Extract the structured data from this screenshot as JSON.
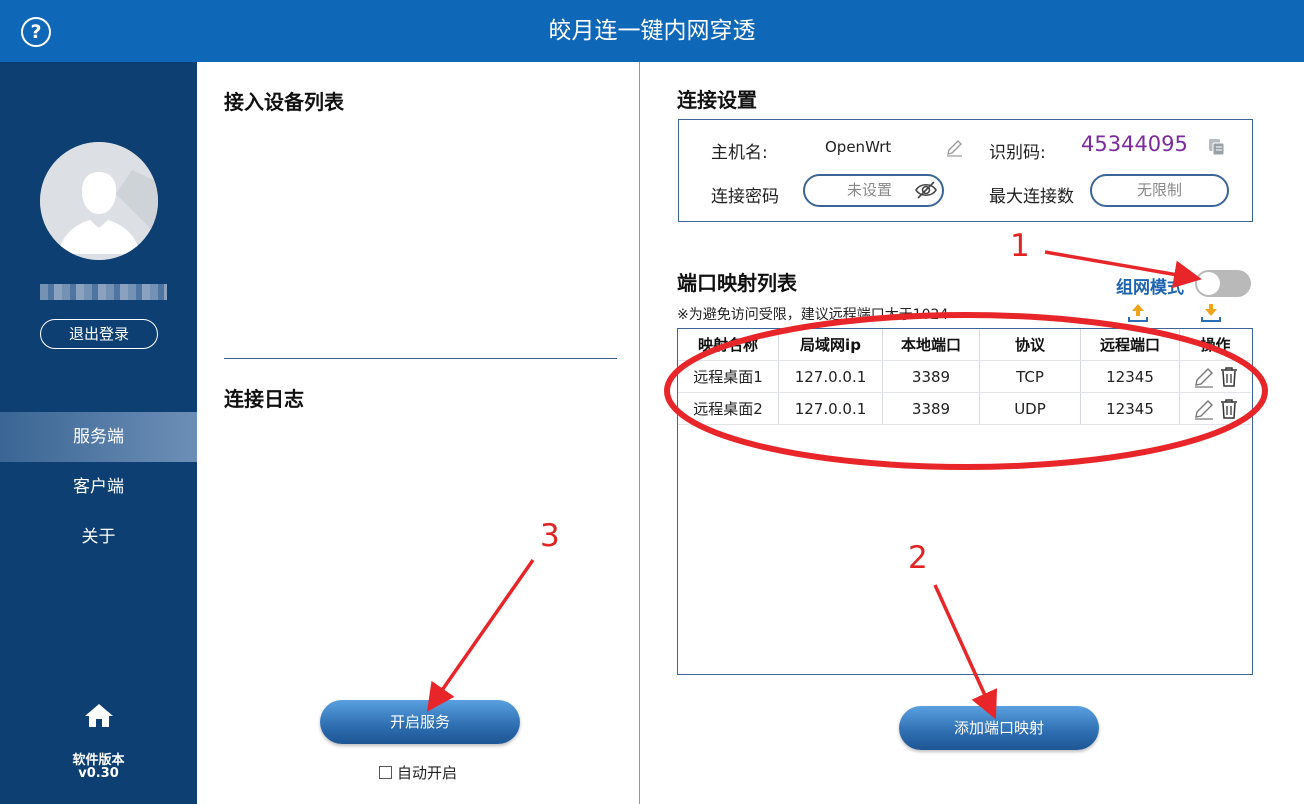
{
  "window": {
    "title": "皎月连一键内网穿透",
    "help_icon": "question-circle-icon"
  },
  "sidebar": {
    "logout_label": "退出登录",
    "nav": [
      {
        "label": "服务端",
        "active": true
      },
      {
        "label": "客户端",
        "active": false
      },
      {
        "label": "关于",
        "active": false
      }
    ],
    "version_label": "软件版本",
    "version": "v0.30"
  },
  "left_panel": {
    "devices_title": "接入设备列表",
    "log_title": "连接日志",
    "start_button": "开启服务",
    "auto_start_label": "自动开启",
    "auto_start_checked": false
  },
  "settings": {
    "title": "连接设置",
    "hostname_label": "主机名:",
    "hostname_value": "OpenWrt",
    "code_label": "识别码:",
    "code_value": "45344095",
    "password_label": "连接密码",
    "password_placeholder": "未设置",
    "max_conn_label": "最大连接数",
    "max_conn_value": "无限制"
  },
  "port_map": {
    "title": "端口映射列表",
    "mode_label": "组网模式",
    "mode_enabled": false,
    "note": "※为避免访问受限，建议远程端口大于1024",
    "columns": [
      "映射名称",
      "局域网ip",
      "本地端口",
      "协议",
      "远程端口",
      "操作"
    ],
    "rows": [
      [
        "远程桌面1",
        "127.0.0.1",
        "3389",
        "TCP",
        "12345"
      ],
      [
        "远程桌面2",
        "127.0.0.1",
        "3389",
        "UDP",
        "12345"
      ]
    ],
    "add_button": "添加端口映射"
  },
  "annotations": [
    "1",
    "2",
    "3"
  ],
  "colors": {
    "titlebar": "#0f67b8",
    "sidebar": "#0d3f73",
    "accent": "#1e63b0",
    "annotation": "#e02424",
    "code": "#7b2a9c"
  }
}
